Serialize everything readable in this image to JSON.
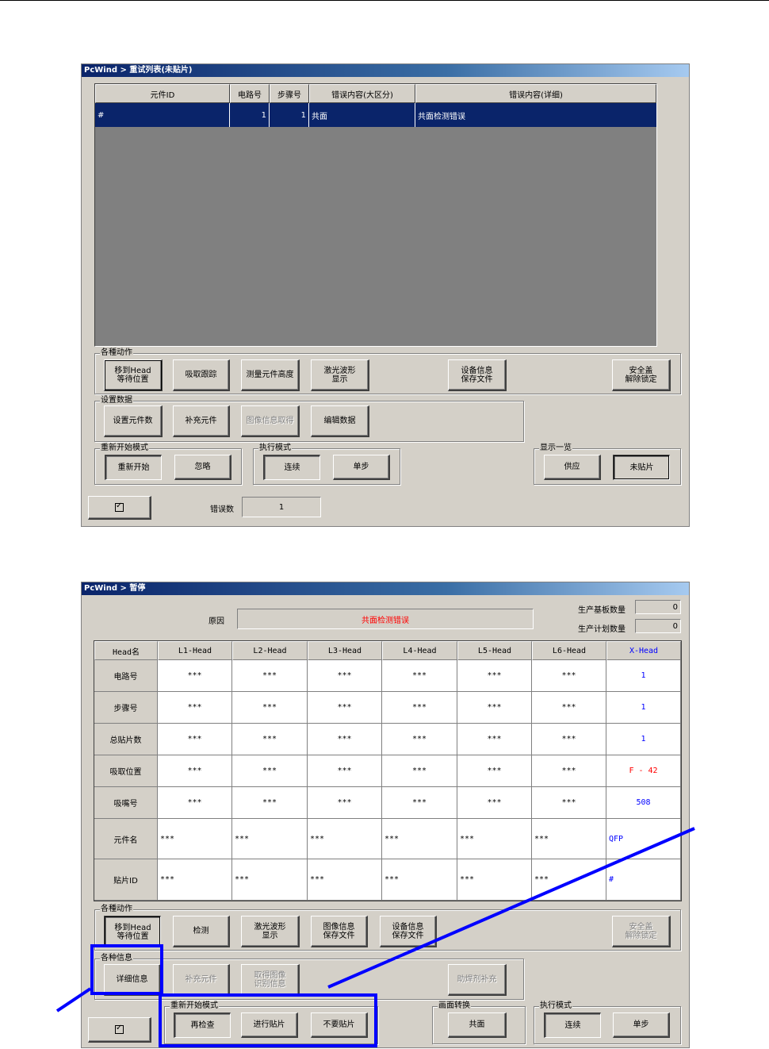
{
  "window1": {
    "title": "PcWind > 重试列表(未贴片)",
    "columns": [
      "元件ID",
      "电路号",
      "步骤号",
      "错误内容(大区分)",
      "错误内容(详细)"
    ],
    "row": {
      "id": "#",
      "circuit": "1",
      "step": "1",
      "major": "共面",
      "detail": "共面检测错误"
    },
    "group_actions": {
      "label": "各種动作",
      "buttons": [
        "移到Head\n等待位置",
        "吸取跟踪",
        "测量元件高度",
        "激光波形\n显示",
        "设备信息\n保存文件",
        "安全盖\n解除锁定"
      ]
    },
    "group_settings": {
      "label": "设置数据",
      "buttons": [
        "设置元件数",
        "补充元件",
        "图像信息取得",
        "编辑数据"
      ]
    },
    "group_restart": {
      "label": "重新开始模式",
      "buttons": [
        "重新开始",
        "忽略"
      ]
    },
    "group_exec": {
      "label": "执行模式",
      "buttons": [
        "连续",
        "单步"
      ]
    },
    "group_display": {
      "label": "显示一览",
      "buttons": [
        "供应",
        "未贴片"
      ]
    },
    "error_count_label": "错误数",
    "error_count": "1"
  },
  "window2": {
    "title": "PcWind > 暂停",
    "reason_label": "原因",
    "reason_value": "共面检测错误",
    "prod_boards_label": "生产基板数量",
    "prod_boards_value": "0",
    "prod_plan_label": "生产计划数量",
    "prod_plan_value": "0",
    "grid_headers": [
      "Head名",
      "L1-Head",
      "L2-Head",
      "L3-Head",
      "L4-Head",
      "L5-Head",
      "L6-Head",
      "X-Head"
    ],
    "grid_rows": [
      {
        "label": "电路号",
        "values": [
          "***",
          "***",
          "***",
          "***",
          "***",
          "***",
          "1"
        ]
      },
      {
        "label": "步骤号",
        "values": [
          "***",
          "***",
          "***",
          "***",
          "***",
          "***",
          "1"
        ]
      },
      {
        "label": "总贴片数",
        "values": [
          "***",
          "***",
          "***",
          "***",
          "***",
          "***",
          "1"
        ]
      },
      {
        "label": "吸取位置",
        "values": [
          "***",
          "***",
          "***",
          "***",
          "***",
          "***",
          "F - 42"
        ]
      },
      {
        "label": "吸嘴号",
        "values": [
          "***",
          "***",
          "***",
          "***",
          "***",
          "***",
          "508"
        ]
      },
      {
        "label": "元件名",
        "values": [
          "***",
          "***",
          "***",
          "***",
          "***",
          "***",
          "QFP"
        ]
      },
      {
        "label": "贴片ID",
        "values": [
          "***",
          "***",
          "***",
          "***",
          "***",
          "***",
          "#"
        ]
      }
    ],
    "group_actions": {
      "label": "各種动作",
      "buttons": [
        "移到Head\n等待位置",
        "检测",
        "激光波形\n显示",
        "图像信息\n保存文件",
        "设备信息\n保存文件",
        "安全盖\n解除锁定"
      ]
    },
    "group_info": {
      "label": "各种信息",
      "buttons": [
        "详细信息",
        "补充元件",
        "取得图像\n识别信息",
        "助焊剂补充"
      ]
    },
    "group_restart": {
      "label": "重新开始模式",
      "buttons": [
        "再检查",
        "进行贴片",
        "不要贴片"
      ]
    },
    "group_screen": {
      "label": "画面转换",
      "buttons": [
        "共面"
      ]
    },
    "group_exec": {
      "label": "执行模式",
      "buttons": [
        "连续",
        "单步"
      ]
    }
  },
  "colors": {
    "highlight": "#0000ff",
    "selection": "#0a246a",
    "window_bg": "#d4d0c8",
    "error_text": "#ff0000"
  }
}
